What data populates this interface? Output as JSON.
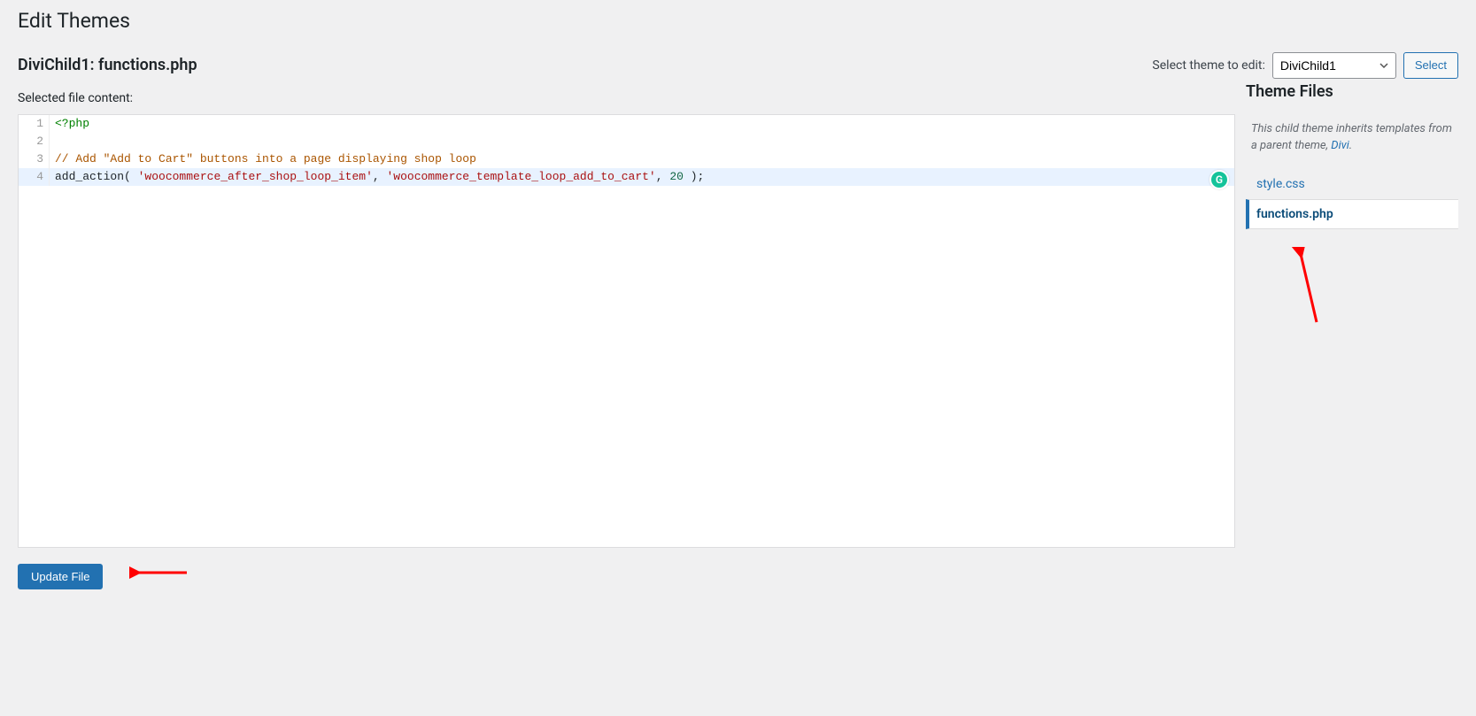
{
  "page_title": "Edit Themes",
  "file_heading": "DiviChild1: functions.php",
  "theme_select_label": "Select theme to edit:",
  "theme_select_value": "DiviChild1",
  "select_button_label": "Select",
  "selected_file_content_label": "Selected file content:",
  "code": {
    "line1": {
      "num": "1",
      "open_tag": "<?php"
    },
    "line2": {
      "num": "2"
    },
    "line3": {
      "num": "3",
      "comment": "// Add \"Add to Cart\" buttons into a page displaying shop loop"
    },
    "line4": {
      "num": "4",
      "func": "add_action",
      "open": "( ",
      "arg1": "'woocommerce_after_shop_loop_item'",
      "sep1": ", ",
      "arg2": "'woocommerce_template_loop_add_to_cart'",
      "sep2": ", ",
      "arg3": "20",
      "close": " );"
    }
  },
  "grammarly_badge": "G",
  "sidebar": {
    "heading": "Theme Files",
    "inherit_text_prefix": "This child theme inherits templates from a parent theme, ",
    "inherit_link": "Divi",
    "inherit_text_suffix": ".",
    "files": [
      {
        "label": "style.css",
        "active": false
      },
      {
        "label": "functions.php",
        "active": true
      }
    ]
  },
  "update_button_label": "Update File"
}
